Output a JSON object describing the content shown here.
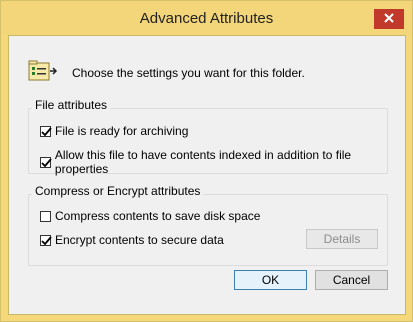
{
  "window": {
    "title": "Advanced Attributes"
  },
  "intro_text": "Choose the settings you want for this folder.",
  "file_attributes": {
    "label": "File attributes",
    "options": [
      {
        "label": "File is ready for archiving",
        "checked": true
      },
      {
        "label": "Allow this file to have contents indexed in addition to file properties",
        "checked": true
      }
    ]
  },
  "compress_encrypt": {
    "label": "Compress or Encrypt attributes",
    "options": [
      {
        "label": "Compress contents to save disk space",
        "checked": false
      },
      {
        "label": "Encrypt contents to secure data",
        "checked": true
      }
    ],
    "details_label": "Details"
  },
  "buttons": {
    "ok": "OK",
    "cancel": "Cancel"
  },
  "icons": {
    "close": "close-icon",
    "folder": "folder-attributes-icon",
    "check": "checkmark-icon"
  },
  "colors": {
    "title_bar": "#f3d679",
    "close_button": "#c0392b",
    "dialog_bg": "#f0f0f0"
  }
}
